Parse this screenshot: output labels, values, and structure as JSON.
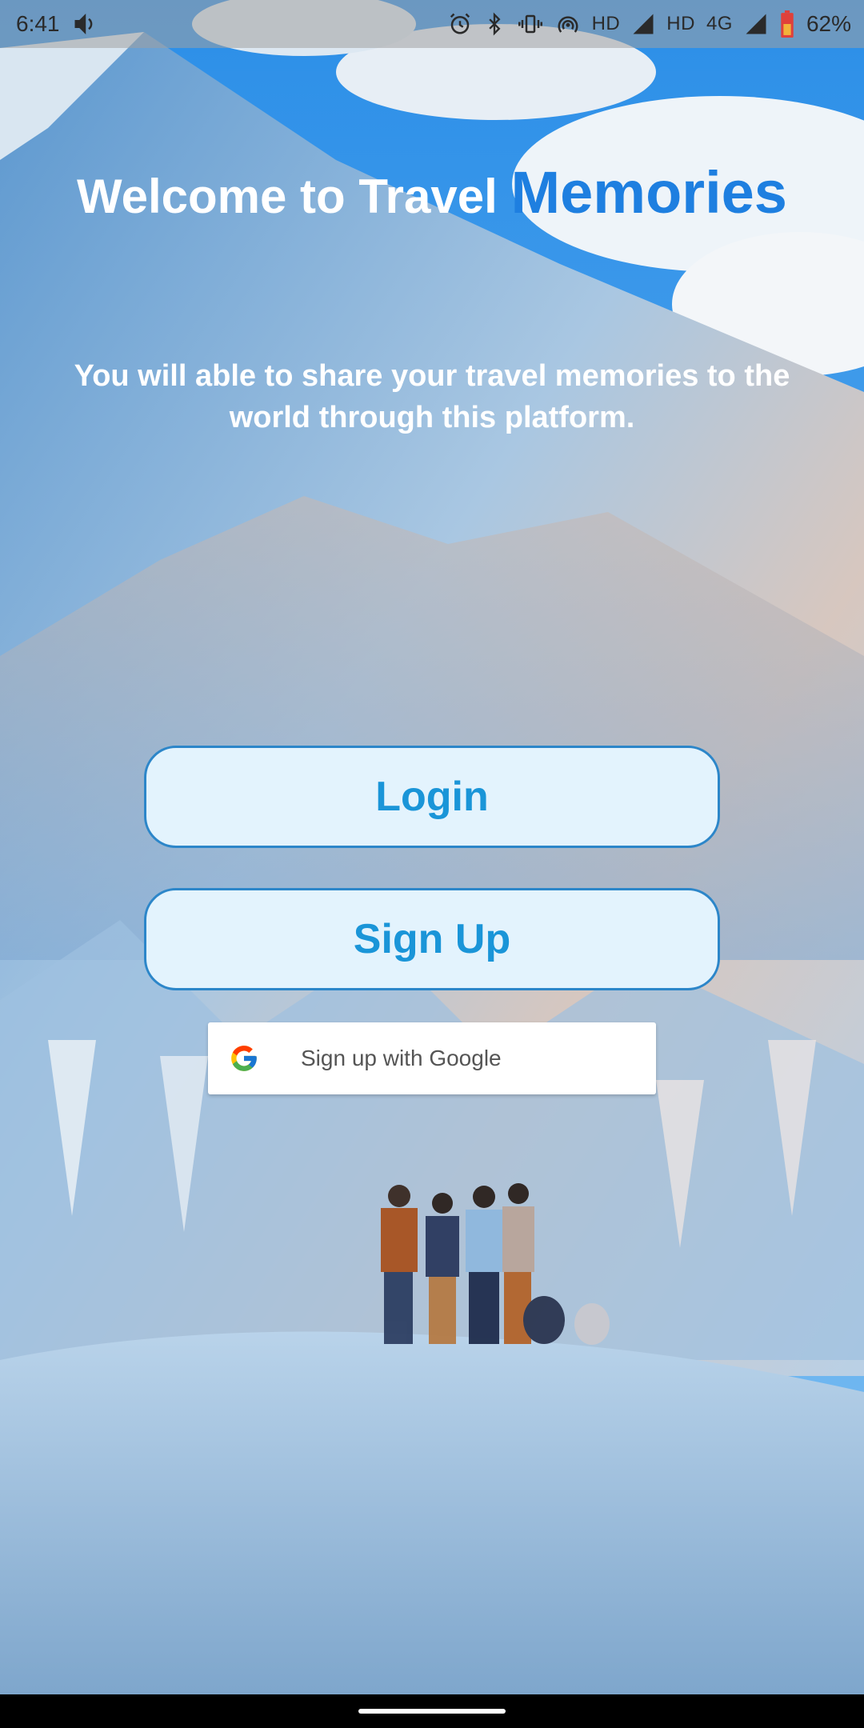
{
  "status_bar": {
    "time": "6:41",
    "network_hd_1": "HD",
    "network_hd_2": "HD",
    "network_type": "4G",
    "battery_percent": "62%"
  },
  "welcome": {
    "title_prefix": "Welcome to Travel ",
    "title_accent": "Memories",
    "subtitle": "You will able to share your travel memories to the world through this platform."
  },
  "buttons": {
    "login_label": "Login",
    "signup_label": "Sign Up",
    "google_label": "Sign up with Google"
  },
  "colors": {
    "accent": "#1e7fe0",
    "button_text": "#1a95d8",
    "button_bg": "#e3f3fd"
  },
  "icons": [
    "volume-icon",
    "alarm-icon",
    "bluetooth-icon",
    "vibrate-icon",
    "hotspot-icon",
    "signal-icon",
    "battery-icon",
    "google-g-icon"
  ]
}
